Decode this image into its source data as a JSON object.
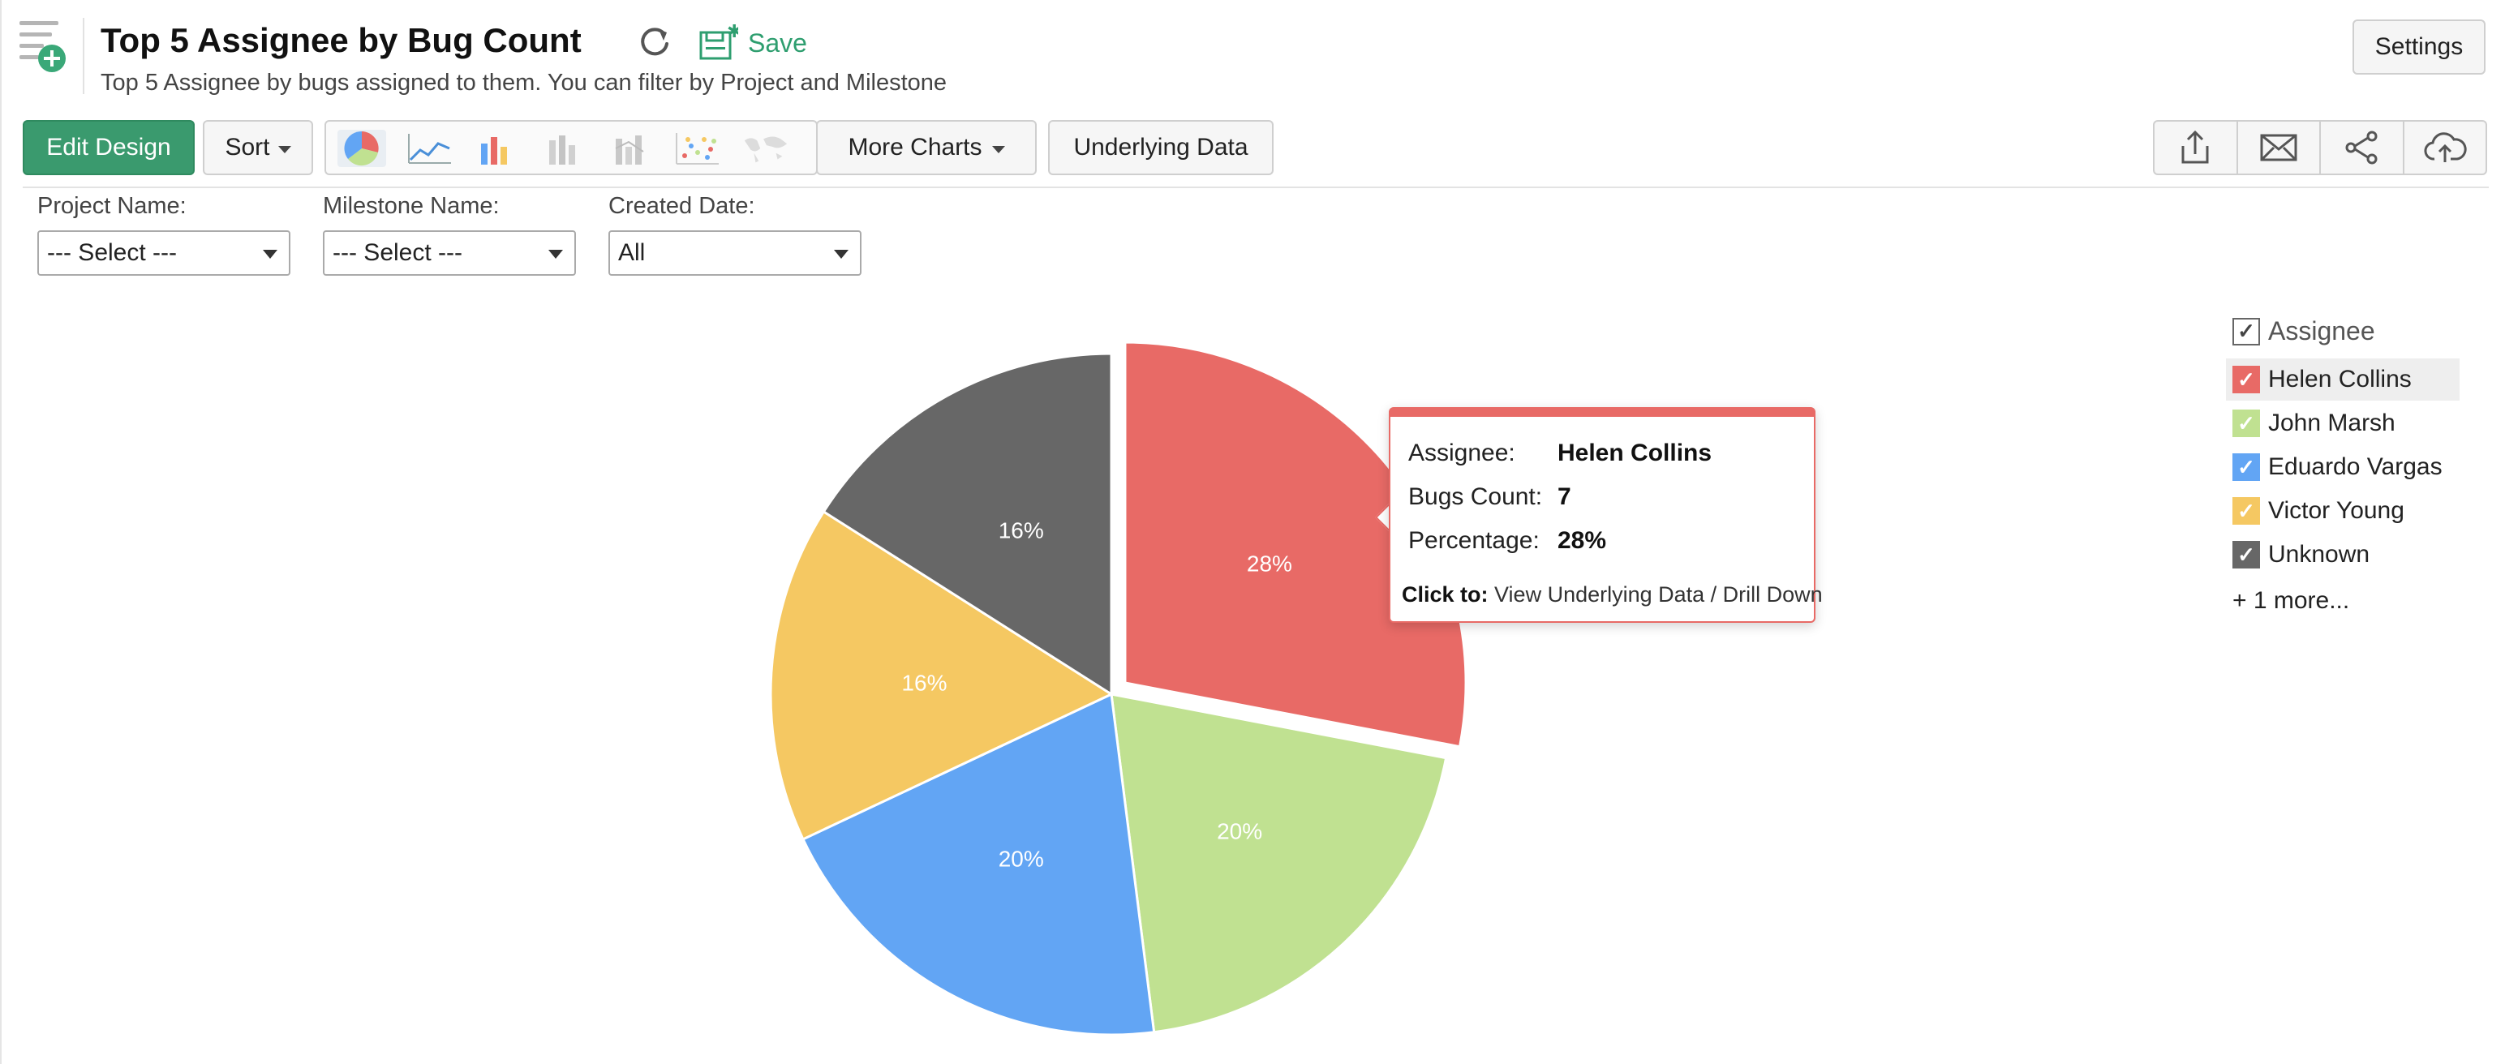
{
  "header": {
    "title": "Top 5 Assignee by Bug Count",
    "subtitle": "Top 5 Assignee by bugs assigned to them. You can filter by Project and Milestone",
    "save_label": "Save",
    "settings_label": "Settings"
  },
  "toolbar": {
    "edit_design_label": "Edit Design",
    "sort_label": "Sort",
    "more_charts_label": "More Charts",
    "underlying_data_label": "Underlying Data",
    "chart_types": [
      "pie-chart-icon",
      "line-chart-icon",
      "bar-chart-icon",
      "stacked-bar-icon",
      "combo-bar-icon",
      "scatter-chart-icon",
      "map-chart-icon"
    ],
    "share_actions": [
      "export-icon",
      "email-icon",
      "share-icon",
      "publish-cloud-icon"
    ]
  },
  "filters": [
    {
      "label": "Project Name:",
      "value": "--- Select ---"
    },
    {
      "label": "Milestone Name:",
      "value": "--- Select ---"
    },
    {
      "label": "Created Date:",
      "value": "All"
    }
  ],
  "legend": {
    "title": "Assignee",
    "items": [
      {
        "name": "Helen Collins",
        "color": "#e86a66"
      },
      {
        "name": "John Marsh",
        "color": "#c0e191"
      },
      {
        "name": "Eduardo Vargas",
        "color": "#62a5f4"
      },
      {
        "name": "Victor Young",
        "color": "#f5c862"
      },
      {
        "name": "Unknown",
        "color": "#676767"
      }
    ],
    "more_label": "+ 1 more..."
  },
  "tooltip": {
    "assignee_key": "Assignee:",
    "assignee_value": "Helen Collins",
    "count_key": "Bugs Count:",
    "count_value": "7",
    "pct_key": "Percentage:",
    "pct_value": "28%",
    "click_prefix": "Click to:",
    "click_actions": "View Underlying Data / Drill Down"
  },
  "chart_data": {
    "type": "pie",
    "categories": [
      "Helen Collins",
      "John Marsh",
      "Eduardo Vargas",
      "Victor Young",
      "Unknown"
    ],
    "values": [
      28,
      20,
      20,
      16,
      16
    ],
    "labels": [
      "28%",
      "20%",
      "20%",
      "16%",
      "16%"
    ],
    "colors": [
      "#e86a66",
      "#c0e191",
      "#62a5f4",
      "#f5c862",
      "#676767"
    ],
    "exploded": "Helen Collins",
    "legend_position": "right"
  }
}
